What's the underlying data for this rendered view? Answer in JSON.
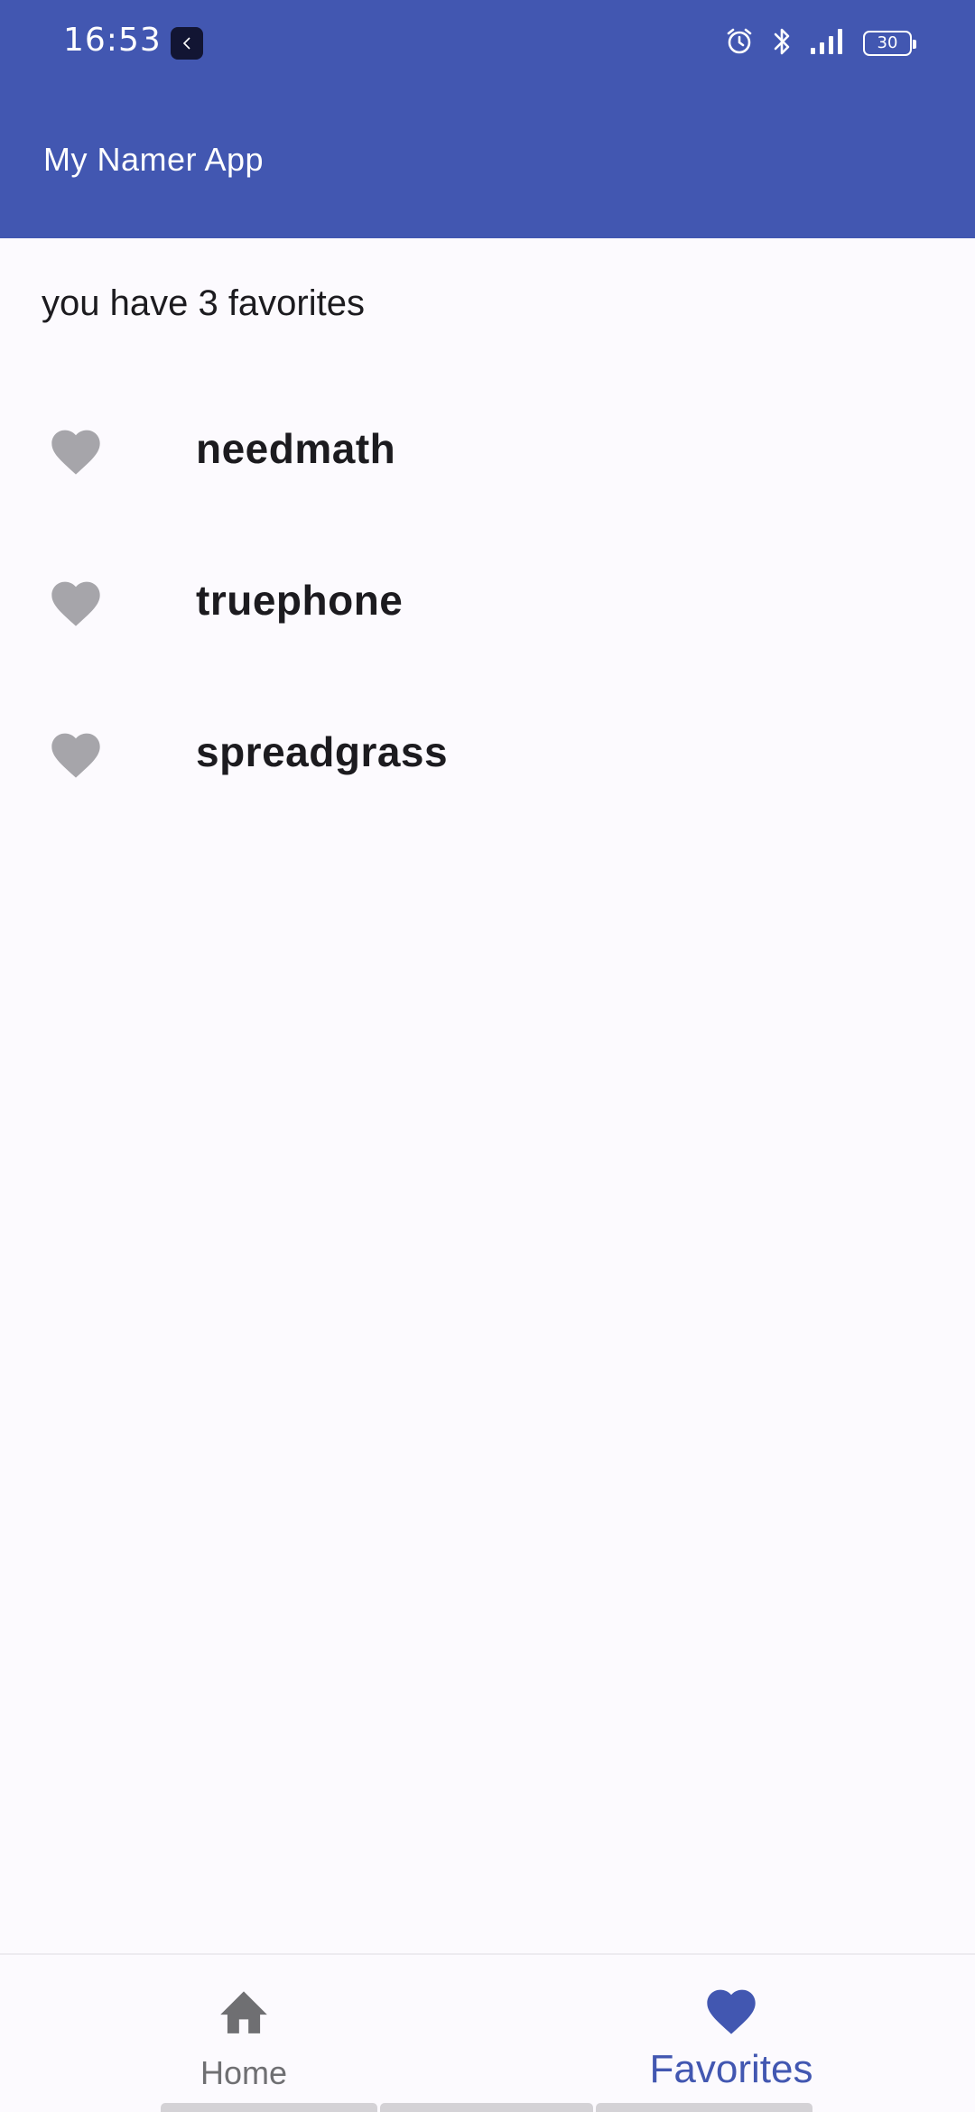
{
  "status_bar": {
    "time": "16:53",
    "battery_level": "30",
    "icons": [
      "app-icon",
      "alarm-icon",
      "bluetooth-icon",
      "signal-icon",
      "battery-icon"
    ]
  },
  "app_bar": {
    "title": "My Namer App",
    "color": "#4257B1"
  },
  "favorites": {
    "count_text": "you have 3 favorites",
    "items": [
      {
        "word": "needmath",
        "icon": "heart-icon"
      },
      {
        "word": "truephone",
        "icon": "heart-icon"
      },
      {
        "word": "spreadgrass",
        "icon": "heart-icon"
      }
    ],
    "icon_color": "#A6A5AA"
  },
  "bottom_nav": {
    "items": [
      {
        "label": "Home",
        "icon": "home-icon",
        "selected": false
      },
      {
        "label": "Favorites",
        "icon": "heart-icon",
        "selected": true
      }
    ],
    "selected_color": "#4257B1",
    "unselected_color": "#6F6F72"
  }
}
